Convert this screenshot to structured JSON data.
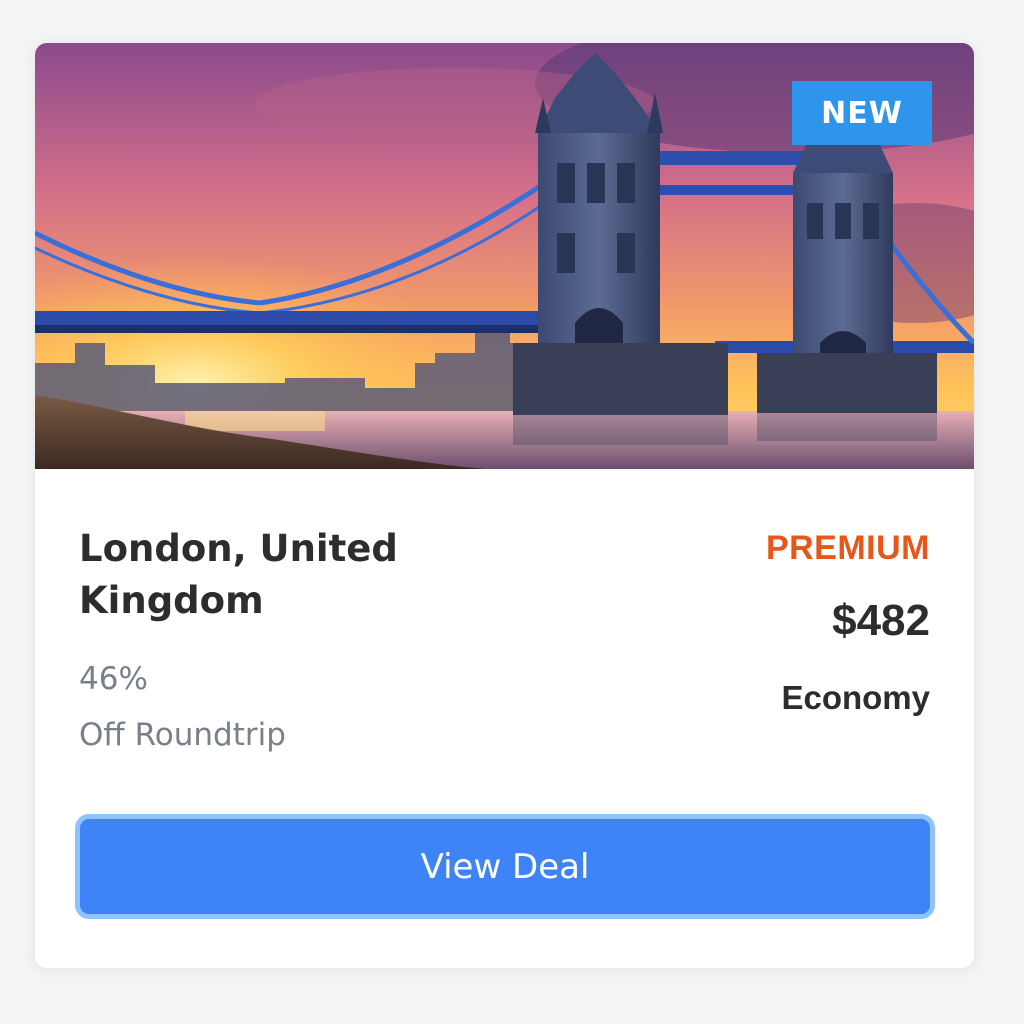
{
  "deal_card": {
    "badge": "NEW",
    "destination": "London, United Kingdom",
    "discount_line1": "46%",
    "discount_line2": "Off Roundtrip",
    "tier": "PREMIUM",
    "price": "$482",
    "cabin_class": "Economy",
    "cta_label": "View Deal"
  },
  "image": {
    "subject": "Tower Bridge at sunset over the River Thames"
  },
  "colors": {
    "badge": "#2e95ec",
    "tier": "#e8571a",
    "button": "#3f84f6",
    "button_border": "#8ec3fb",
    "title_text": "#2d2d2d",
    "muted_text": "#7a8089"
  }
}
